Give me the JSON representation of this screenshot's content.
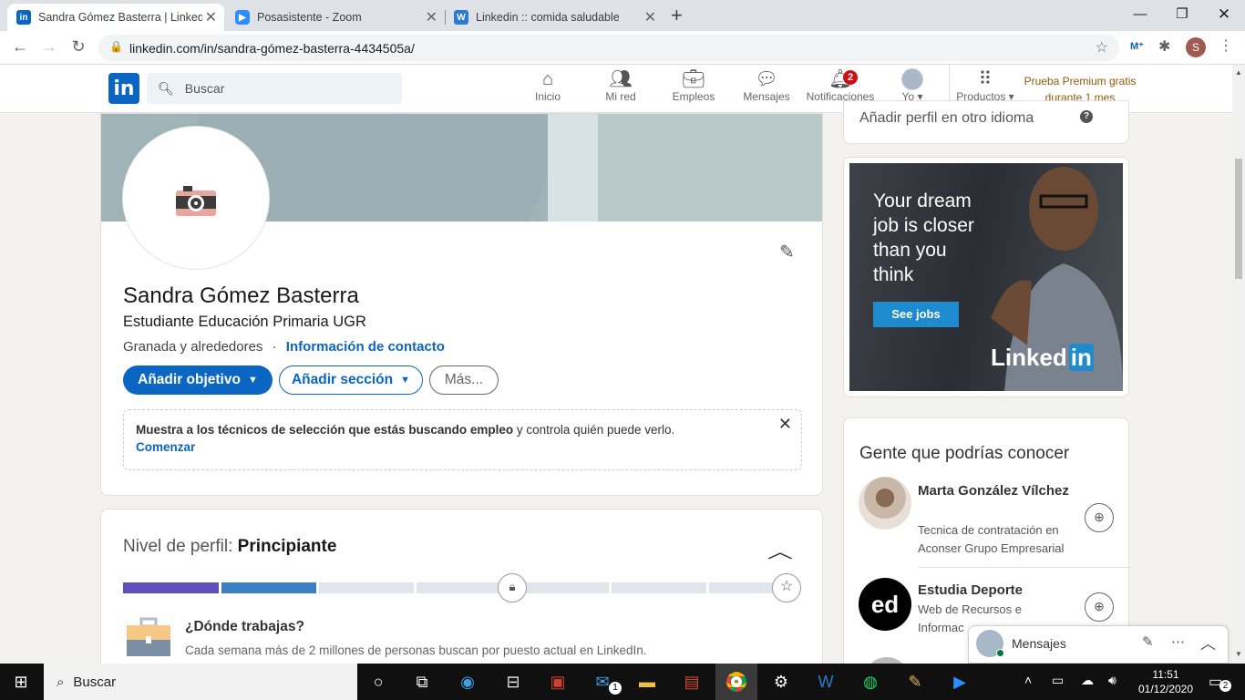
{
  "browser": {
    "tabs": [
      {
        "title": "Sandra Gómez Basterra | LinkedIn",
        "icon": "linkedin-icon",
        "color": "#0a66c2"
      },
      {
        "title": "Posasistente - Zoom",
        "icon": "zoom-icon",
        "color": "#2d8cff"
      },
      {
        "title": "Linkedin :: comida saludable",
        "icon": "word-icon",
        "color": "#2b7cd3"
      }
    ],
    "url": "linkedin.com/in/sandra-gómez-basterra-4434505a/",
    "profile_initial": "S"
  },
  "header": {
    "search_placeholder": "Buscar",
    "nav": [
      {
        "label": "Inicio",
        "icon": "home-icon"
      },
      {
        "label": "Mi red",
        "icon": "network-icon"
      },
      {
        "label": "Empleos",
        "icon": "briefcase-icon"
      },
      {
        "label": "Mensajes",
        "icon": "chat-icon"
      },
      {
        "label": "Notificaciones",
        "icon": "bell-icon",
        "badge": "2"
      },
      {
        "label": "Yo",
        "icon": "avatar-icon"
      },
      {
        "label": "Productos",
        "icon": "grid-icon"
      }
    ],
    "premium_line1": "Prueba Premium gratis",
    "premium_line2": "durante 1 mes"
  },
  "profile": {
    "name": "Sandra Gómez Basterra",
    "headline": "Estudiante Educación Primaria UGR",
    "location": "Granada y alrededores",
    "separator": "·",
    "contact_link": "Información de contacto",
    "btn_objective": "Añadir objetivo",
    "btn_section": "Añadir sección",
    "btn_more": "Más...",
    "hint_bold": "Muestra a los técnicos de selección que estás buscando empleo",
    "hint_rest": " y controla quién puede verlo.",
    "hint_link": "Comenzar"
  },
  "level": {
    "label": "Nivel de perfil: ",
    "value": "Principiante",
    "filled_segments": 2,
    "total_segments": 7,
    "question": "¿Dónde trabajas?",
    "desc": "Cada semana más de 2 millones de personas buscan por puesto actual en LinkedIn."
  },
  "sidebar": {
    "other_language": "Añadir perfil en otro idioma",
    "ad_text": "Your dream job is closer than you think",
    "ad_button": "See jobs",
    "ad_brand": "Linked",
    "ad_brand_in": "in",
    "people_title": "Gente que podrías conocer",
    "people": [
      {
        "name": "Marta González Vílchez",
        "desc": "Tecnica de contratación en Aconser Grupo Empresarial"
      },
      {
        "name": "Estudia Deporte",
        "desc": "Web de Recursos e Informac"
      }
    ],
    "messages_label": "Mensajes"
  },
  "taskbar": {
    "search_label": "Buscar",
    "time": "11:51",
    "date": "01/12/2020",
    "notif_count": "2",
    "mail_count": "1"
  }
}
